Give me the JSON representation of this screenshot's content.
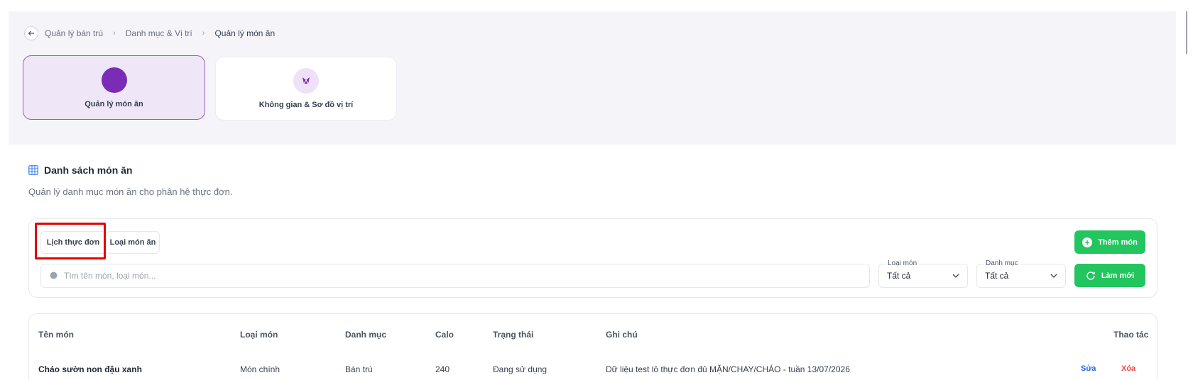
{
  "breadcrumb": {
    "items": [
      "Quản lý bán trú",
      "Danh mục & Vị trí",
      "Quản lý món ăn"
    ]
  },
  "modules": [
    {
      "label": "Quản lý món ăn",
      "active": true,
      "icon": "food-circle-icon"
    },
    {
      "label": "Không gian & Sơ đồ vị trí",
      "active": false,
      "icon": "map-pin-icon"
    }
  ],
  "section": {
    "title": "Danh sách món ăn",
    "subtitle": "Quản lý danh mục món ăn cho phân hệ thực đơn."
  },
  "toolbar": {
    "tabs": [
      "Lịch thực đơn",
      "Loại món ăn"
    ],
    "add_label": "Thêm món",
    "refresh_label": "Làm mới"
  },
  "search": {
    "placeholder": "Tìm tên món, loại món..."
  },
  "filters": {
    "type": {
      "label": "Loại món",
      "value": "Tất cả"
    },
    "category": {
      "label": "Danh mục",
      "value": "Tất cả"
    }
  },
  "table": {
    "headers": [
      "Tên món",
      "Loại món",
      "Danh mục",
      "Calo",
      "Trạng thái",
      "Ghi chú",
      "Thao tác"
    ],
    "rows": [
      {
        "name": "Cháo sườn non đậu xanh",
        "type": "Món chính",
        "category": "Bán trú",
        "calo": "240",
        "status": "Đang sử dụng",
        "note": "Dữ liệu test lô thực đơn đủ MẶN/CHAY/CHÁO - tuần 13/07/2026",
        "edit": "Sửa",
        "delete": "Xóa"
      }
    ]
  },
  "colors": {
    "accent": "#7b2cb6",
    "primary_green": "#22c55e",
    "edit": "#2563eb",
    "delete": "#ef4444",
    "highlight": "#e10600"
  }
}
